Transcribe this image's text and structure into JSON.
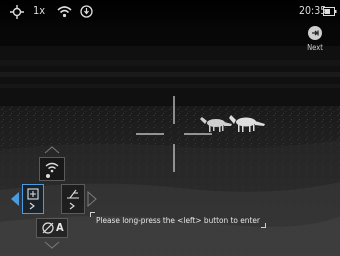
{
  "status_bar": {
    "zoom": "1x",
    "time": "20:35",
    "icons": [
      "target-icon",
      "wifi-icon",
      "record-status-icon",
      "battery-icon"
    ]
  },
  "next_button": {
    "label": "Next",
    "icon": "arrow-into-circle-icon"
  },
  "menu": {
    "items": [
      {
        "name": "wifi",
        "icon": "wifi-icon"
      },
      {
        "name": "zoom-in",
        "icon": "zoom-in-icon",
        "selected": true
      },
      {
        "name": "calibrate",
        "icon": "calibrate-icon"
      },
      {
        "name": "auto-calibration",
        "icon": "no-auto-icon",
        "label": "A"
      }
    ]
  },
  "hint": {
    "text": "Please long-press the <left> button to enter"
  },
  "colors": {
    "accent": "#4a9be0",
    "foreground": "#e6e6e6"
  }
}
